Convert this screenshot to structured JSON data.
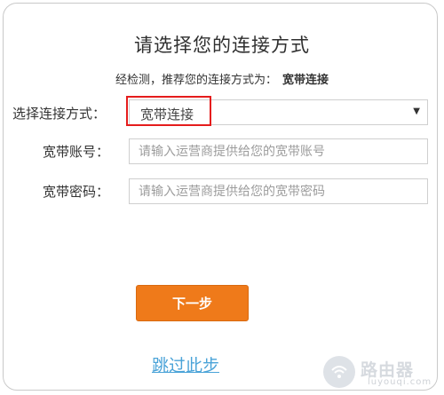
{
  "title": "请选择您的连接方式",
  "detection": {
    "prefix": "经检测，推荐您的连接方式为：",
    "recommended": "宽带连接"
  },
  "form": {
    "connection_label": "选择连接方式：",
    "connection_value": "宽带连接",
    "account_label": "宽带账号：",
    "account_placeholder": "请输入运营商提供给您的宽带账号",
    "password_label": "宽带密码：",
    "password_placeholder": "请输入运营商提供给您的宽带密码"
  },
  "buttons": {
    "next": "下一步",
    "skip": "跳过此步"
  },
  "watermark": {
    "name": "路由器",
    "site": "luyouqi.com"
  },
  "colors": {
    "primary_button": "#ef7a1a",
    "link": "#4aa3d8",
    "highlight": "#e51c1c"
  }
}
